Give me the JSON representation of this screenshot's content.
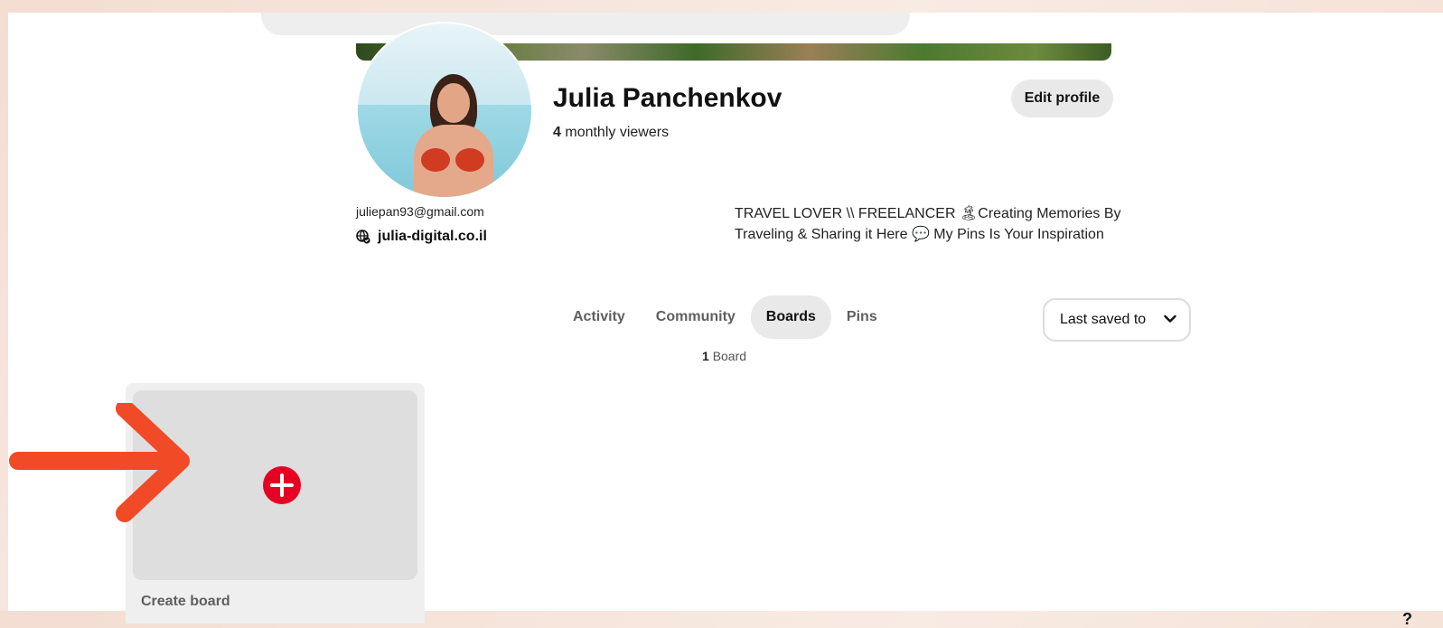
{
  "profile": {
    "name": "Julia Panchenkov",
    "viewers_count": "4",
    "viewers_label": "monthly viewers",
    "edit_profile_label": "Edit profile",
    "email": "juliepan93@gmail.com",
    "website": "julia-digital.co.il",
    "bio": "TRAVEL LOVER \\\\ FREELANCER 🏝Creating Memories By Traveling & Sharing it Here 💬 My Pins Is Your Inspiration"
  },
  "tabs": [
    {
      "label": "Activity",
      "active": false
    },
    {
      "label": "Community",
      "active": false
    },
    {
      "label": "Boards",
      "active": true
    },
    {
      "label": "Pins",
      "active": false
    }
  ],
  "sort": {
    "label": "Last saved to",
    "icon": "chevron-down-icon"
  },
  "boards": {
    "count": "1",
    "count_label": "Board"
  },
  "create_board": {
    "label": "Create board",
    "icon": "plus-circle-icon"
  },
  "annotation": {
    "arrow_color": "#f04a26",
    "icon": "arrow-right-icon"
  },
  "colors": {
    "accent_red": "#e60023",
    "tab_active_bg": "#e9e9e9"
  }
}
